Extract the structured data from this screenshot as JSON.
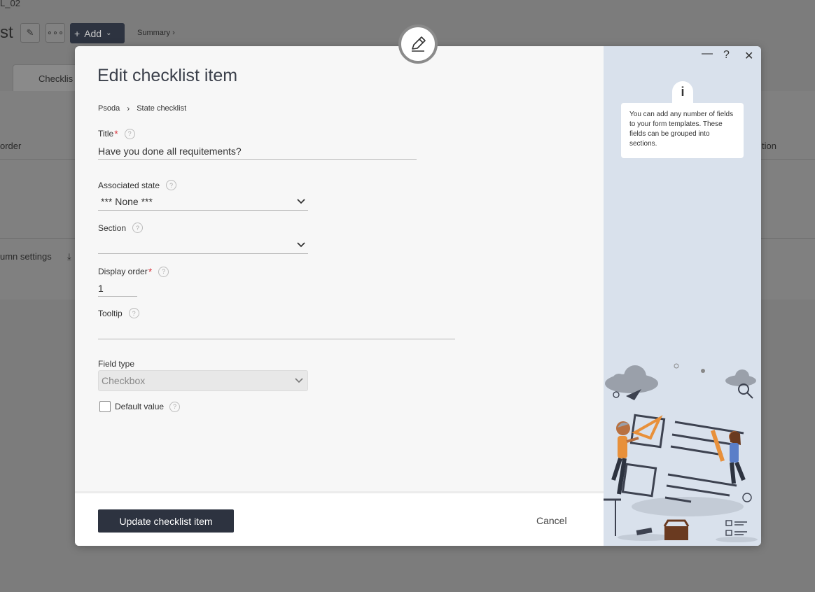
{
  "background": {
    "code": "L_02",
    "title": "st",
    "add_label": "Add",
    "summary_link": "Summary ›",
    "tab_label": "Checklis",
    "col_left": "order",
    "col_right": "tion",
    "column_settings": "umn settings"
  },
  "modal": {
    "title": "Edit checklist item",
    "breadcrumb": [
      "Psoda",
      "State checklist"
    ],
    "fields": {
      "title": {
        "label": "Title",
        "value": "Have you done all requitements?"
      },
      "associated_state": {
        "label": "Associated state",
        "value": "*** None ***"
      },
      "section": {
        "label": "Section",
        "value": ""
      },
      "display_order": {
        "label": "Display order",
        "value": "1"
      },
      "tooltip": {
        "label": "Tooltip",
        "value": ""
      },
      "field_type": {
        "label": "Field type",
        "value": "Checkbox"
      },
      "default_value": {
        "label": "Default value",
        "checked": false
      }
    },
    "footer": {
      "submit_label": "Update checklist item",
      "cancel_label": "Cancel"
    },
    "side_panel": {
      "info_icon": "i",
      "info_text": "You can add any number of fields to your form templates. These fields can be grouped into sections."
    }
  },
  "colors": {
    "primary_button": "#2d3340",
    "required_marker": "#d9363e",
    "side_panel_bg": "#d9e1ec"
  }
}
